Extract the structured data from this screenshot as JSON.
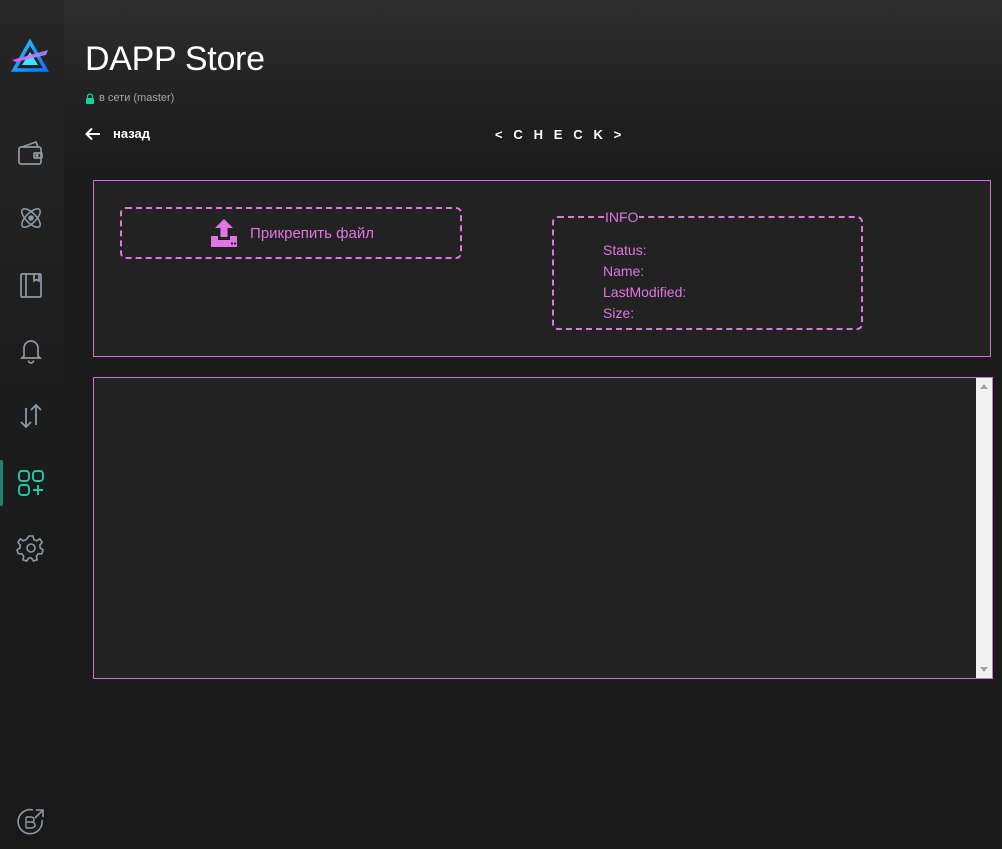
{
  "app": {
    "title": "DAPP Store",
    "status": "в сети (master)"
  },
  "sidebar": {
    "items": [
      {
        "name": "wallet-icon"
      },
      {
        "name": "atom-icon"
      },
      {
        "name": "notebook-icon"
      },
      {
        "name": "bell-icon"
      },
      {
        "name": "transfer-arrows-icon"
      },
      {
        "name": "dapps-grid-icon",
        "active": true
      },
      {
        "name": "gear-icon"
      }
    ],
    "footer_icon": "beam-explorer-external-icon"
  },
  "nav": {
    "back_label": "назад",
    "page_heading": "< C H E C K >"
  },
  "upload": {
    "button_label": "Прикрепить файл",
    "icon": "upload-icon"
  },
  "info": {
    "legend": "INFO",
    "fields": [
      {
        "label": "Status:",
        "value": ""
      },
      {
        "label": "Name:",
        "value": ""
      },
      {
        "label": "LastModified:",
        "value": ""
      },
      {
        "label": "Size:",
        "value": ""
      }
    ]
  },
  "output": {
    "value": ""
  },
  "colors": {
    "accent": "#e274e6",
    "border": "#d26ed6",
    "active": "#24c9a8",
    "background": "#1a1a1a"
  }
}
